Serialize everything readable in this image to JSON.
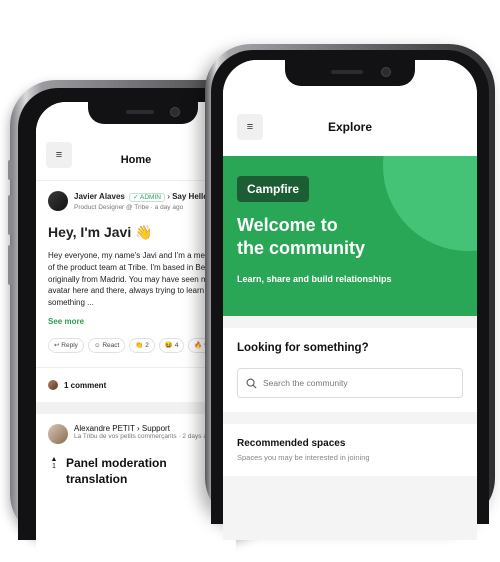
{
  "home": {
    "title": "Home",
    "menu_icon": "≡",
    "post1": {
      "author": "Javier Alaves",
      "badge": "ADMIN",
      "space": "Say Hello",
      "subtitle": "Product Designer @ Tribe · a day ago",
      "title": "Hey, I'm Javi 👋",
      "body": "Hey everyone, my name's Javi and I'm a member of the product team at Tribe. I'm based in Berlin, originally from Madrid. You may have seen my avatar here and there, always trying to learn something ...",
      "see_more": "See more",
      "actions": {
        "reply": "Reply",
        "react": "React",
        "clap": "👏 2",
        "smile": "😆 4",
        "fire": "🔥 9"
      },
      "comments": "1 comment"
    },
    "post2": {
      "author": "Alexandre PETIT",
      "space": "Support",
      "subtitle": "La Tribu de vos petits commerçants · 2 days ago",
      "votes": "1",
      "title_line1": "Panel moderation",
      "title_line2": "translation"
    }
  },
  "explore": {
    "title": "Explore",
    "menu_icon": "≡",
    "logo": "Campfire",
    "hero_title_line1": "Welcome to",
    "hero_title_line2": "the community",
    "hero_subtitle": "Learn, share and build relationships",
    "search_heading": "Looking for something?",
    "search_placeholder": "Search the community",
    "recommended_title": "Recommended spaces",
    "recommended_subtitle": "Spaces you may be interested in joining"
  },
  "colors": {
    "brand_green": "#2aa657",
    "brand_dark_green": "#1c5d34",
    "link_green": "#2e9b53"
  }
}
